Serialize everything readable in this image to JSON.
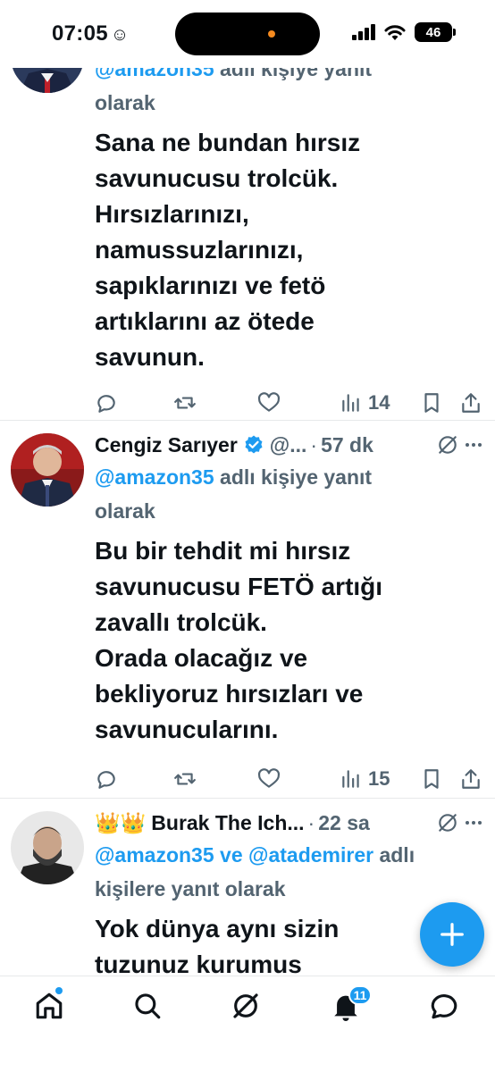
{
  "status_bar": {
    "time": "07:05",
    "emoji": "☺",
    "battery": "46"
  },
  "tweets": [
    {
      "reply_handle": "@amazon35",
      "reply_suffix": " adlı kişiye yanıt",
      "reply_line2": "olarak",
      "text_lines": [
        "Sana ne bundan hırsız",
        "savunucusu trolcük.",
        "Hırsızlarınızı,",
        "namussuzlarınızı,",
        "sapıklarınızı ve fetö",
        "artıklarını az ötede",
        "savunun."
      ],
      "views": "14"
    },
    {
      "name": "Cengiz Sarıyer",
      "handle": "@...",
      "time": "57 dk",
      "reply_handle": "@amazon35",
      "reply_suffix": " adlı kişiye yanıt",
      "reply_line2": "olarak",
      "text_lines": [
        "Bu bir tehdit mi hırsız",
        "savunucusu FETÖ artığı",
        "zavallı trolcük.",
        "Orada olacağız ve",
        "bekliyoruz hırsızları ve",
        "savunucularını."
      ],
      "views": "15"
    },
    {
      "name_prefix": "👑👑",
      "name": "Burak The Ich...",
      "time": "22 sa",
      "reply_handle1": "@amazon35",
      "reply_and": " ve ",
      "reply_handle2": "@atademirer",
      "reply_suffix": " adlı",
      "reply_line2": "kişilere yanıt olarak",
      "text_lines": [
        "Yok dünya aynı sizin",
        "tuzunuz kurumus"
      ]
    }
  ],
  "nav": {
    "notifications_count": "11"
  },
  "colors": {
    "accent": "#1d9bf0",
    "muted": "#536471",
    "text": "#0f1419"
  }
}
